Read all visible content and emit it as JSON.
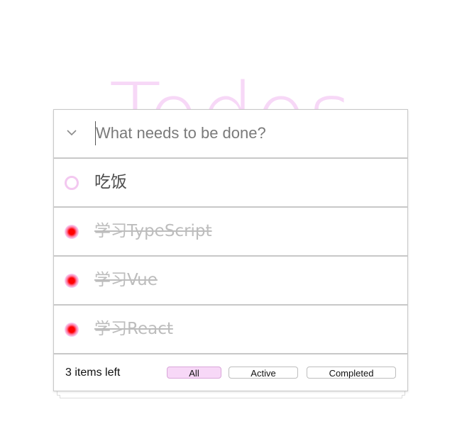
{
  "header": {
    "title": "Todos",
    "input_placeholder": "What needs to be done?",
    "input_value": ""
  },
  "todos": [
    {
      "label": "吃饭",
      "completed": false
    },
    {
      "label": "学习TypeScript",
      "completed": true
    },
    {
      "label": "学习Vue",
      "completed": true
    },
    {
      "label": "学习React",
      "completed": true
    }
  ],
  "footer": {
    "items_left": "3 items left",
    "filters": [
      {
        "label": "All",
        "selected": true
      },
      {
        "label": "Active",
        "selected": false
      },
      {
        "label": "Completed",
        "selected": false
      }
    ]
  },
  "icons": {
    "toggle_all": "chevron-down-icon",
    "todo_open": "circle-outline-icon",
    "todo_done": "radio-filled-icon"
  },
  "colors": {
    "title": "#f7d8f7",
    "selected_filter": "#f7d8f7",
    "done_check_center": "#ff0000",
    "open_check_ring": "#f3c8f0",
    "completed_text": "#bdbdbd"
  }
}
